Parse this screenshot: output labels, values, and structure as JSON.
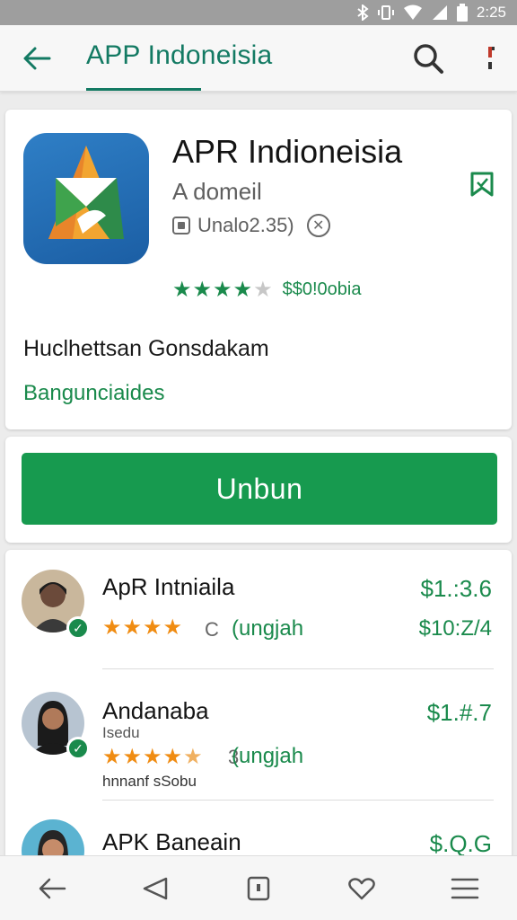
{
  "status_bar": {
    "time": "2:25",
    "icons": [
      "bluetooth-icon",
      "vibrate-icon",
      "wifi-icon",
      "signal-icon",
      "battery-icon"
    ]
  },
  "app_bar": {
    "title": "APP Indoneisia",
    "icons": [
      "back-arrow-icon",
      "search-icon",
      "more-icon"
    ]
  },
  "app": {
    "name": "APR Indioneisia",
    "developer": "A domeil",
    "meta": "Unalo2.35)",
    "rating_stars": 4.5,
    "rating_text": "$$0!0obia",
    "description": "Huclhettsan Gonsdakam",
    "category": "Bangunciaides"
  },
  "install_button": {
    "label": "Unbun"
  },
  "list": [
    {
      "name": "ApR Intniaila",
      "stars": 4,
      "number": "C",
      "link": "(ungjah",
      "price": "$1.:3.6",
      "price2": "$10:Z/4",
      "subtitle": "",
      "footer": ""
    },
    {
      "name": "Andanaba",
      "stars": 4.5,
      "number": "3",
      "link": "(ungjah",
      "price": "$1.#.7",
      "price2": "",
      "subtitle": "Isedu",
      "footer": "hnnanf sSobu"
    },
    {
      "name": "APK Baneain",
      "stars": 0,
      "number": "",
      "link": "",
      "price": "$.Q.G",
      "price2": "",
      "subtitle": "",
      "footer": ""
    }
  ],
  "colors": {
    "accent_green": "#1a8a4c",
    "title_teal": "#137a63",
    "button_green": "#179a4f",
    "star_orange": "#f08c12"
  },
  "nav_bar": {
    "icons": [
      "back-nav-icon",
      "home-triangle-icon",
      "square-nav-icon",
      "heart-icon",
      "menu-icon"
    ]
  }
}
